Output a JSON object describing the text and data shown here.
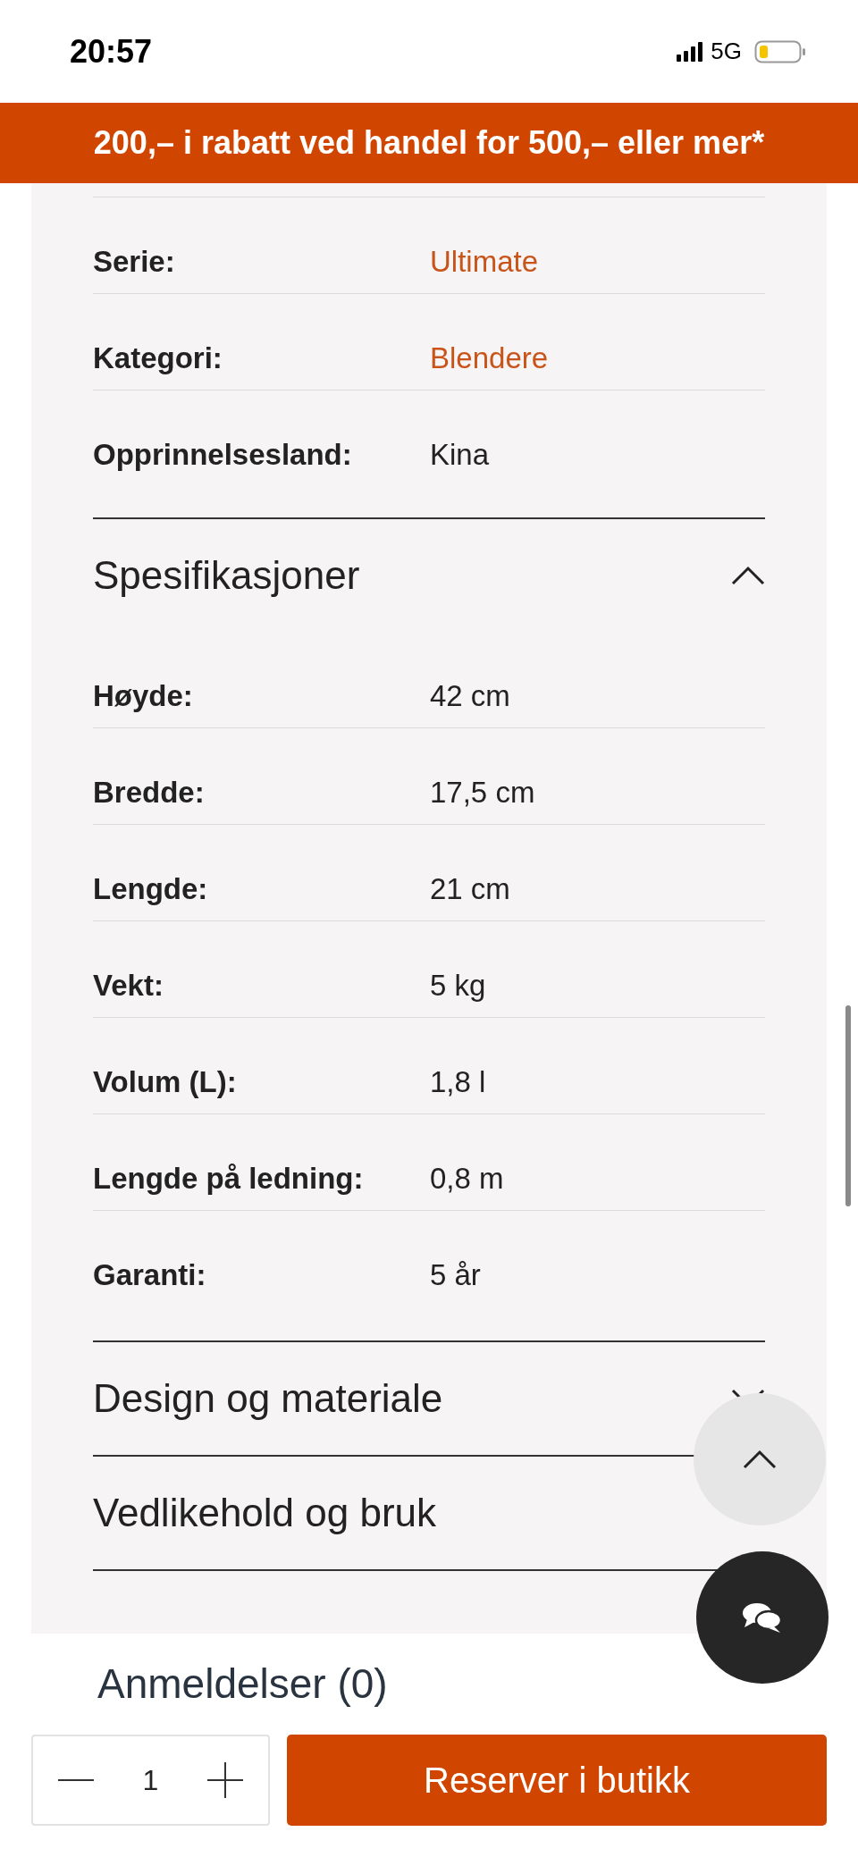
{
  "status_bar": {
    "time": "20:57",
    "network": "5G"
  },
  "promo_banner": {
    "text": "200,– i rabatt ved handel for 500,– eller mer*"
  },
  "details": [
    {
      "label": "Serie:",
      "value": "Ultimate",
      "kind": "link"
    },
    {
      "label": "Kategori:",
      "value": "Blendere",
      "kind": "link"
    },
    {
      "label": "Opprinnelsesland:",
      "value": "Kina",
      "kind": "text"
    }
  ],
  "sections": [
    {
      "title": "Spesifikasjoner",
      "expanded": true,
      "rows": [
        {
          "label": "Høyde:",
          "value": "42 cm"
        },
        {
          "label": "Bredde:",
          "value": "17,5 cm"
        },
        {
          "label": "Lengde:",
          "value": "21 cm"
        },
        {
          "label": "Vekt:",
          "value": "5 kg"
        },
        {
          "label": "Volum (L):",
          "value": "1,8 l"
        },
        {
          "label": "Lengde på ledning:",
          "value": "0,8 m"
        },
        {
          "label": "Garanti:",
          "value": "5 år"
        }
      ]
    },
    {
      "title": "Design og materiale",
      "expanded": false
    },
    {
      "title": "Vedlikehold og bruk"
    }
  ],
  "reviews": {
    "title": "Anmeldelser (0)"
  },
  "cart_bar": {
    "quantity": "1",
    "button": "Reserver i butikk"
  }
}
